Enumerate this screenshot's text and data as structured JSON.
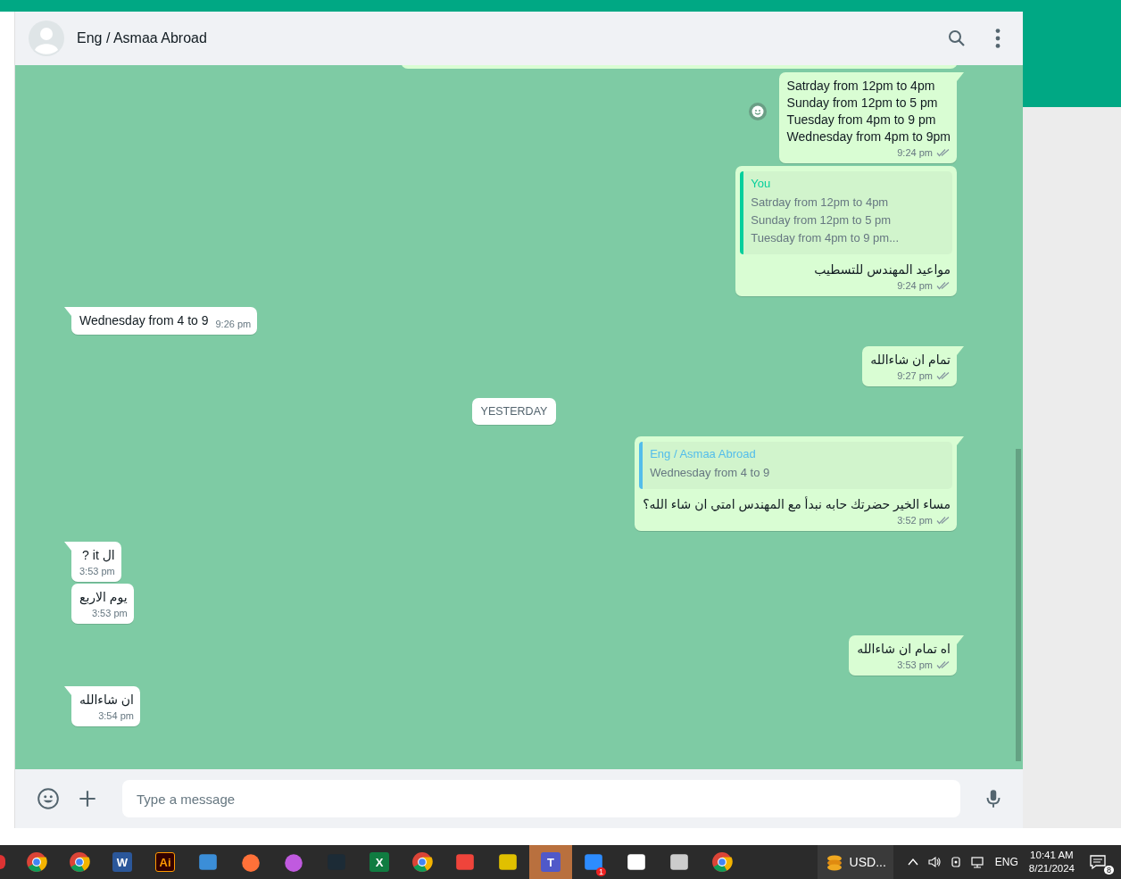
{
  "chat_header": {
    "contact_name": "Eng / Asmaa Abroad"
  },
  "messages": [
    {
      "kind": "out",
      "text": "Satrday from 12pm to 4pm\nSunday from 12pm to 5 pm\nTuesday from 4pm to 9 pm\nWednesday from 4pm to 9pm",
      "time": "9:24 pm",
      "read": true,
      "reaction_button": true
    },
    {
      "kind": "out",
      "quote": {
        "author": "You",
        "color": "#06cf9c",
        "text": "Satrday from 12pm to 4pm\nSunday from 12pm to 5 pm\nTuesday from 4pm to 9 pm..."
      },
      "text": "مواعيد المهندس للتسطيب",
      "time": "9:24 pm",
      "read": true
    },
    {
      "kind": "in",
      "text": "Wednesday from 4 to 9",
      "time": "9:26 pm",
      "inline_time": true
    },
    {
      "kind": "out",
      "text": "تمام ان شاءالله",
      "time": "9:27 pm",
      "read": true
    },
    {
      "kind": "date",
      "text": "YESTERDAY"
    },
    {
      "kind": "out",
      "quote": {
        "author": "Eng / Asmaa Abroad",
        "color": "#53bdeb",
        "text": "Wednesday from 4 to 9"
      },
      "text": "مساء الخير حضرتك حابه نبدأ مع المهندس امتي ان شاء الله؟",
      "time": "3:52 pm",
      "read": true
    },
    {
      "kind": "in",
      "text": "ال it ?",
      "time": "3:53 pm"
    },
    {
      "kind": "in",
      "text": "يوم الاربع",
      "time": "3:53 pm"
    },
    {
      "kind": "out",
      "text": "اه تمام ان شاءالله",
      "time": "3:53 pm",
      "read": true
    },
    {
      "kind": "in",
      "text": "ان شاءالله",
      "time": "3:54 pm"
    }
  ],
  "composer": {
    "placeholder": "Type a message"
  },
  "taskbar": {
    "apps": [
      {
        "kind": "chrome"
      },
      {
        "kind": "chrome"
      },
      {
        "kind": "word",
        "label": "W"
      },
      {
        "kind": "illustrator",
        "label": "Ai"
      },
      {
        "kind": "photos"
      },
      {
        "kind": "firefox"
      },
      {
        "kind": "drop"
      },
      {
        "kind": "filmora"
      },
      {
        "kind": "excel",
        "label": "X"
      },
      {
        "kind": "chrome"
      },
      {
        "kind": "anydesk"
      },
      {
        "kind": "paint"
      },
      {
        "kind": "teams",
        "label": "T",
        "selected": true
      },
      {
        "kind": "zoom",
        "badge": "1"
      },
      {
        "kind": "pdf"
      },
      {
        "kind": "printer"
      },
      {
        "kind": "chrome"
      }
    ],
    "currency": "USD...",
    "language": "ENG",
    "time": "10:41 AM",
    "date": "8/21/2024",
    "notifications": "8"
  }
}
